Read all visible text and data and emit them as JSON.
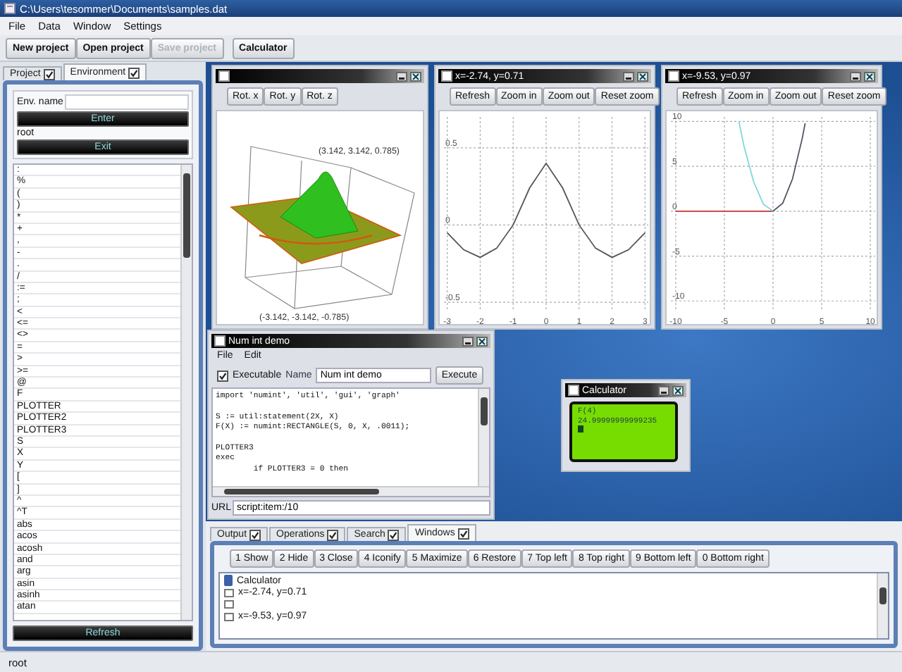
{
  "window": {
    "title": "C:\\Users\\tesommer\\Documents\\samples.dat"
  },
  "menu": [
    {
      "label": "File"
    },
    {
      "label": "Data"
    },
    {
      "label": "Window"
    },
    {
      "label": "Settings"
    }
  ],
  "toolbar": {
    "project_buttons": [
      {
        "label": "New project",
        "disabled": false
      },
      {
        "label": "Open project",
        "disabled": false
      },
      {
        "label": "Save project",
        "disabled": true
      }
    ],
    "tool_buttons": [
      {
        "label": "Calculator",
        "disabled": false
      }
    ]
  },
  "sidebar": {
    "tabs": [
      {
        "label": "Project",
        "checked": true,
        "selected": false
      },
      {
        "label": "Environment",
        "checked": true,
        "selected": true
      }
    ],
    "env_name_label": "Env. name",
    "enter_button": "Enter",
    "current_env": "root",
    "exit_button": "Exit",
    "symbols": [
      ":",
      "%",
      "(",
      ")",
      "*",
      "+",
      ",",
      "-",
      ".",
      "/",
      ":=",
      ";",
      "<",
      "<=",
      "<>",
      "=",
      ">",
      ">=",
      "@",
      "F",
      "PLOTTER",
      "PLOTTER2",
      "PLOTTER3",
      "S",
      "X",
      "Y",
      "[",
      "]",
      "^",
      "^T",
      "abs",
      "acos",
      "acosh",
      "and",
      "arg",
      "asin",
      "asinh",
      "atan"
    ],
    "refresh_button": "Refresh"
  },
  "surface_window": {
    "buttons": [
      "Rot. x",
      "Rot. y",
      "Rot. z"
    ],
    "corner_max": "(3.142, 3.142, 0.785)",
    "corner_min": "(-3.142, -3.142, -0.785)"
  },
  "plot_windows": [
    {
      "title": "x=-2.74,  y=0.71",
      "buttons": [
        "Refresh",
        "Zoom in",
        "Zoom out",
        "Reset zoom"
      ],
      "chart_data": {
        "type": "line",
        "x": [
          -3,
          -2.5,
          -2,
          -1.5,
          -1,
          -0.5,
          0,
          0.5,
          1,
          1.5,
          2,
          2.5,
          3
        ],
        "series": [
          {
            "color": "#555555",
            "values": [
              -0.05,
              -0.16,
              -0.21,
              -0.15,
              0,
              0.24,
              0.4,
              0.24,
              0,
              -0.15,
              -0.21,
              -0.16,
              -0.05
            ]
          }
        ],
        "grid": true,
        "xlim": [
          -3.1,
          3.1
        ],
        "ylim": [
          -0.55,
          0.7
        ],
        "xticks": [
          -3,
          -2,
          -1,
          0,
          1,
          2,
          3
        ],
        "yticks": [
          -0.5,
          0,
          0.5
        ]
      }
    },
    {
      "title": "x=-9.53,  y=0.97",
      "buttons": [
        "Refresh",
        "Zoom in",
        "Zoom out",
        "Reset zoom"
      ],
      "chart_data": {
        "type": "line",
        "x": [
          -10,
          -5,
          -3.5,
          -3,
          -2,
          -1,
          0,
          1,
          2,
          3,
          3.3
        ],
        "series": [
          {
            "color": "#cc3333",
            "values": [
              0,
              0,
              0,
              0,
              0,
              0,
              0,
              null,
              null,
              null,
              null
            ]
          },
          {
            "color": "#7fd8d8",
            "values": [
              null,
              null,
              10,
              7.3,
              3.3,
              0.8,
              0,
              null,
              null,
              null,
              null
            ]
          },
          {
            "color": "#555566",
            "values": [
              null,
              null,
              null,
              null,
              null,
              null,
              0,
              0.9,
              3.6,
              8.1,
              9.8
            ]
          }
        ],
        "grid": true,
        "xlim": [
          -10.5,
          10.5
        ],
        "ylim": [
          -11,
          10.5
        ],
        "xticks": [
          -10,
          -5,
          0,
          5,
          10
        ],
        "yticks": [
          -10,
          -5,
          0,
          5,
          10
        ]
      }
    }
  ],
  "script_window": {
    "title": "Num int demo",
    "menu": [
      "File",
      "Edit"
    ],
    "executable": {
      "label": "Executable",
      "checked": true
    },
    "name_label": "Name",
    "name_value": "Num int demo",
    "execute_button": "Execute",
    "code": "import 'numint', 'util', 'gui', 'graph'\n\nS := util:statement(2X, X)\nF(X) := numint:RECTANGLE(S, 0, X, .0011);\n\nPLOTTER3\nexec\n        if PLOTTER3 = 0 then",
    "url_label": "URL",
    "url_value": "script:item:/10"
  },
  "calculator": {
    "title": "Calculator",
    "display": [
      "F(4)",
      "24.99999999999235"
    ]
  },
  "bottom_panel": {
    "tabs": [
      {
        "label": "Output",
        "checked": true,
        "selected": false
      },
      {
        "label": "Operations",
        "checked": true,
        "selected": false
      },
      {
        "label": "Search",
        "checked": true,
        "selected": false
      },
      {
        "label": "Windows",
        "checked": true,
        "selected": true
      }
    ],
    "buttons": [
      "1 Show",
      "2 Hide",
      "3 Close",
      "4 Iconify",
      "5 Maximize",
      "6 Restore",
      "7 Top left",
      "8 Top right",
      "9 Bottom left",
      "0 Bottom right"
    ],
    "window_list": [
      {
        "kind": "calculator",
        "title": "Calculator"
      },
      {
        "kind": "window",
        "title": "x=-2.74,  y=0.71"
      },
      {
        "kind": "window"
      },
      {
        "kind": "window",
        "title": "x=-9.53,  y=0.97"
      }
    ]
  },
  "status_bar": "root"
}
